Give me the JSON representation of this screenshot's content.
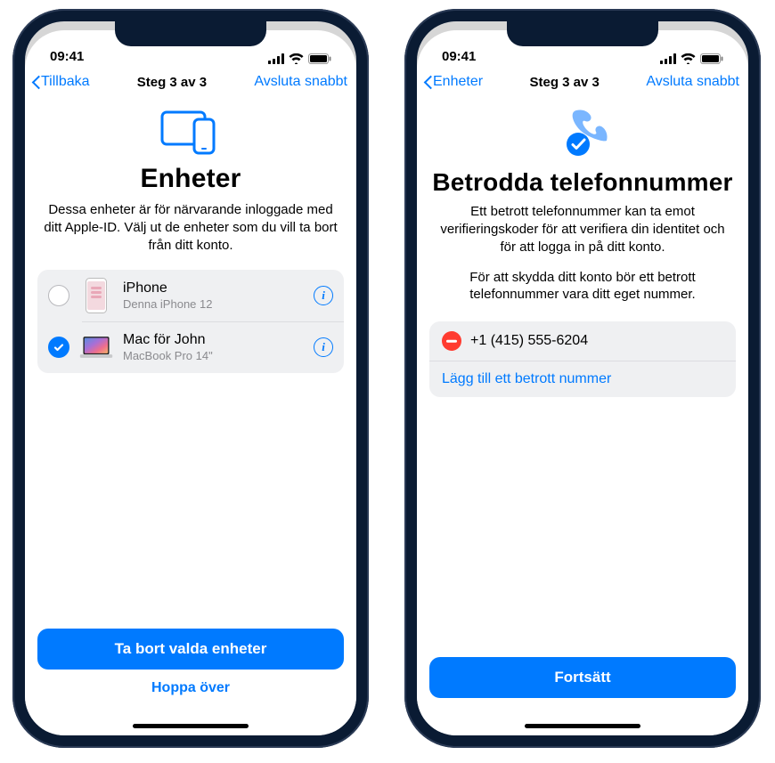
{
  "phone1": {
    "status": {
      "time": "09:41"
    },
    "nav": {
      "back_label": "Tillbaka",
      "step": "Steg 3 av 3",
      "quit": "Avsluta snabbt"
    },
    "hero": {
      "title": "Enheter",
      "subtitle": "Dessa enheter är för närvarande inloggade med ditt Apple-ID. Välj ut de enheter som du vill ta bort från ditt konto."
    },
    "devices": [
      {
        "name": "iPhone",
        "model": "Denna iPhone 12",
        "selected": false
      },
      {
        "name": "Mac för John",
        "model": "MacBook Pro 14\"",
        "selected": true
      }
    ],
    "remove_button": "Ta bort valda enheter",
    "skip_button": "Hoppa över"
  },
  "phone2": {
    "status": {
      "time": "09:41"
    },
    "nav": {
      "back_label": "Enheter",
      "step": "Steg 3 av 3",
      "quit": "Avsluta snabbt"
    },
    "hero": {
      "title": "Betrodda telefonnummer",
      "subtitle1": "Ett betrott telefonnummer kan ta emot verifieringskoder för att verifiera din identitet och för att logga in på ditt konto.",
      "subtitle2": "För att skydda ditt konto bör ett betrott telefonnummer vara ditt eget nummer."
    },
    "numbers": [
      {
        "number": "+1 (415) 555-6204"
      }
    ],
    "add_number": "Lägg till ett betrott nummer",
    "continue_button": "Fortsätt"
  }
}
